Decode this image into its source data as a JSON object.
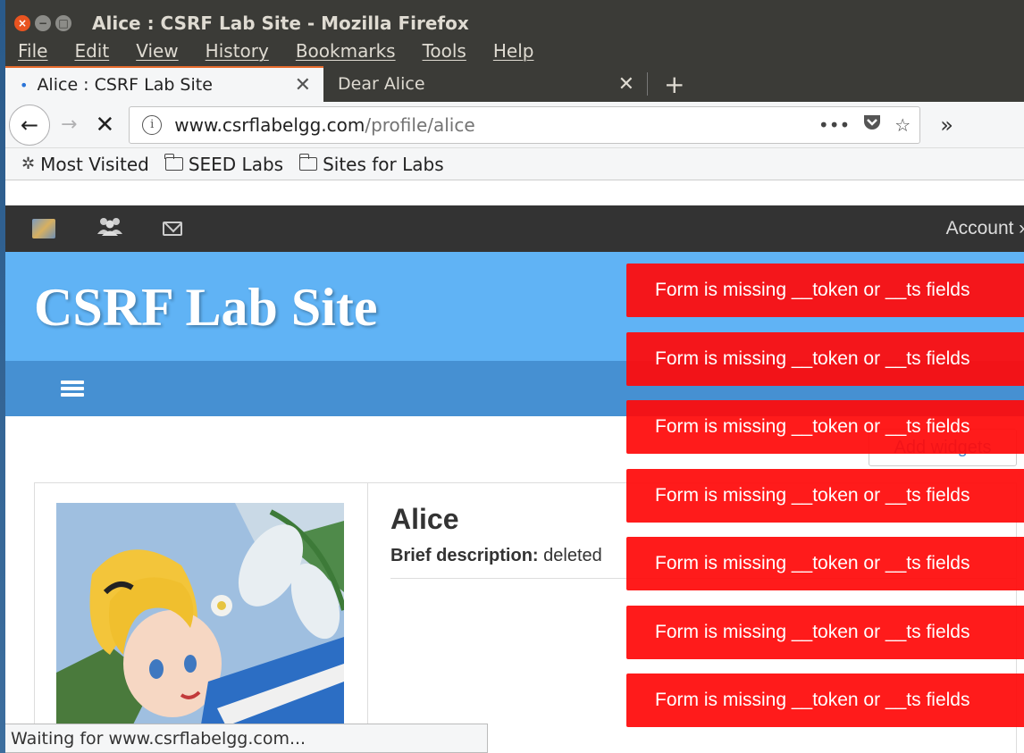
{
  "window": {
    "title": "Alice : CSRF Lab Site - Mozilla Firefox",
    "controls": [
      "close",
      "minimize",
      "maximize"
    ]
  },
  "menu": [
    "File",
    "Edit",
    "View",
    "History",
    "Bookmarks",
    "Tools",
    "Help"
  ],
  "tabs": [
    {
      "label": "Alice : CSRF Lab Site",
      "active": true,
      "loading": true
    },
    {
      "label": "Dear Alice",
      "active": false
    }
  ],
  "nav": {
    "url_domain": "www.csrflabelgg.com",
    "url_path": "/profile/alice",
    "page_actions_icon": "•••"
  },
  "bookmarks": [
    {
      "label": "Most Visited",
      "icon": "gear-icon"
    },
    {
      "label": "SEED Labs",
      "icon": "folder-icon"
    },
    {
      "label": "Sites for Labs",
      "icon": "folder-icon"
    }
  ],
  "site": {
    "account": "Account »",
    "title": "CSRF Lab Site",
    "add_widgets": "Add widgets"
  },
  "profile": {
    "name": "Alice",
    "desc_label": "Brief description:",
    "desc_value": " deleted"
  },
  "errors": [
    "Form is missing __token or __ts fields",
    "Form is missing __token or __ts fields",
    "Form is missing __token or __ts fields",
    "Form is missing __token or __ts fields",
    "Form is missing __token or __ts fields",
    "Form is missing __token or __ts fields",
    "Form is missing __token or __ts fields"
  ],
  "status": "Waiting for www.csrflabelgg.com...",
  "colors": {
    "titlebar": "#3b3b37",
    "tab_accent": "#e66a2c",
    "site_header": "#60b3f5",
    "site_subnav": "#4690d2",
    "error": "#ff0a0a"
  }
}
